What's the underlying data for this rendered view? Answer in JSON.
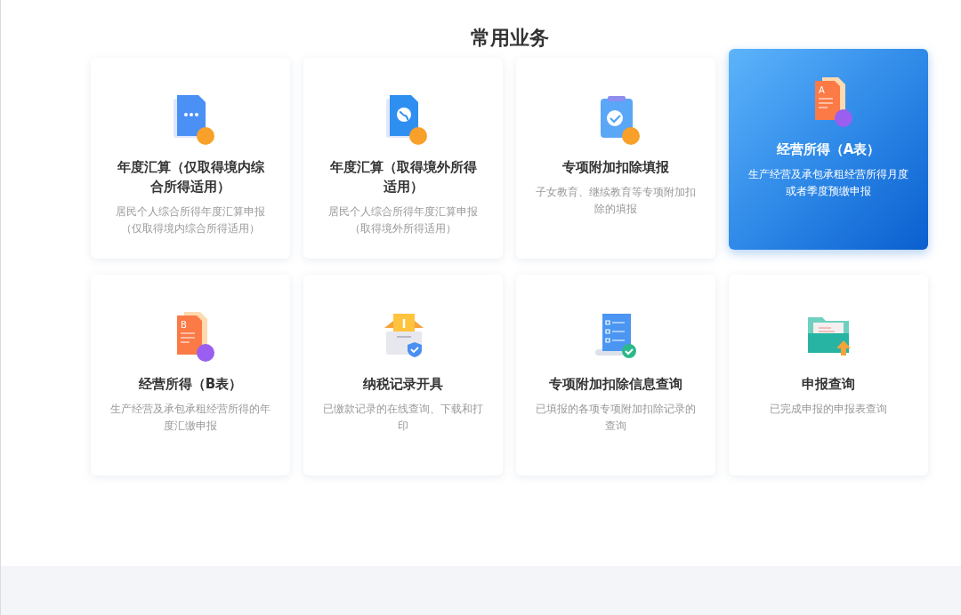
{
  "section_title": "常用业务",
  "cards": [
    {
      "kind": "doc-dots",
      "title": "年度汇算（仅取得境内综合所得适用）",
      "description": "居民个人综合所得年度汇算申报（仅取得境内综合所得适用）",
      "selected": false
    },
    {
      "kind": "doc-globe",
      "title": "年度汇算（取得境外所得适用）",
      "description": "居民个人综合所得年度汇算申报（取得境外所得适用）",
      "selected": false
    },
    {
      "kind": "clipboard",
      "title": "专项附加扣除填报",
      "description": "子女教育、继续教育等专项附加扣除的填报",
      "selected": false
    },
    {
      "kind": "letter-doc",
      "icon_letter": "A",
      "title": "经营所得（A表）",
      "description": "生产经营及承包承租经营所得月度或者季度预缴申报",
      "selected": true
    },
    {
      "kind": "letter-doc",
      "icon_letter": "B",
      "title": "经营所得（B表）",
      "description": "生产经营及承包承租经营所得的年度汇缴申报",
      "selected": false
    },
    {
      "kind": "mailbox",
      "title": "纳税记录开具",
      "description": "已缴款记录的在线查询、下载和打印",
      "selected": false
    },
    {
      "kind": "scroll",
      "title": "专项附加扣除信息查询",
      "description": "已填报的各项专项附加扣除记录的查询",
      "selected": false
    },
    {
      "kind": "folder",
      "title": "申报查询",
      "description": "已完成申报的申报表查询",
      "selected": false
    }
  ]
}
